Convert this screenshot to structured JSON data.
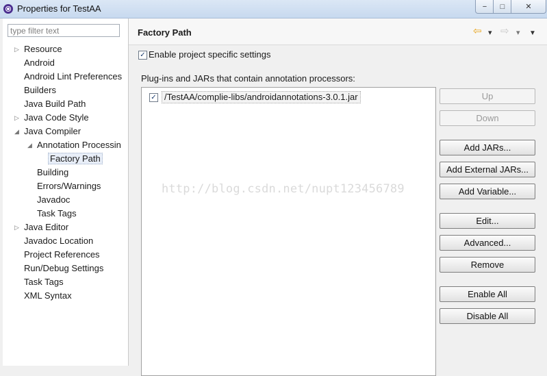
{
  "window": {
    "title": "Properties for TestAA",
    "min_label": "−",
    "max_label": "□",
    "close_label": "✕"
  },
  "filter": {
    "placeholder": "type filter text"
  },
  "tree": [
    {
      "label": "Resource",
      "expander": "▷"
    },
    {
      "label": "Android",
      "expander": ""
    },
    {
      "label": "Android Lint Preferences",
      "expander": ""
    },
    {
      "label": "Builders",
      "expander": ""
    },
    {
      "label": "Java Build Path",
      "expander": ""
    },
    {
      "label": "Java Code Style",
      "expander": "▷"
    },
    {
      "label": "Java Compiler",
      "expander": "◢"
    },
    {
      "label": "Annotation Processin",
      "expander": "◢"
    },
    {
      "label": "Factory Path",
      "expander": ""
    },
    {
      "label": "Building",
      "expander": ""
    },
    {
      "label": "Errors/Warnings",
      "expander": ""
    },
    {
      "label": "Javadoc",
      "expander": ""
    },
    {
      "label": "Task Tags",
      "expander": ""
    },
    {
      "label": "Java Editor",
      "expander": "▷"
    },
    {
      "label": "Javadoc Location",
      "expander": ""
    },
    {
      "label": "Project References",
      "expander": ""
    },
    {
      "label": "Run/Debug Settings",
      "expander": ""
    },
    {
      "label": "Task Tags",
      "expander": ""
    },
    {
      "label": "XML Syntax",
      "expander": ""
    }
  ],
  "page": {
    "title": "Factory Path",
    "enable_label": "Enable project specific settings",
    "enable_checked": true,
    "plugins_label": "Plug-ins and JARs that contain annotation processors:",
    "jars": [
      {
        "path": "/TestAA/complie-libs/androidannotations-3.0.1.jar",
        "checked": true
      }
    ]
  },
  "buttons": {
    "up": "Up",
    "down": "Down",
    "add_jars": "Add JARs...",
    "add_external_jars": "Add External JARs...",
    "add_variable": "Add Variable...",
    "edit": "Edit...",
    "advanced": "Advanced...",
    "remove": "Remove",
    "enable_all": "Enable All",
    "disable_all": "Disable All"
  },
  "nav_icons": {
    "back": "⇦",
    "dropdown": "▾",
    "forward": "⇨",
    "menu": "▼"
  },
  "watermark": "http://blog.csdn.net/nupt123456789",
  "colors": {
    "back_arrow": "#e8a317",
    "forward_arrow": "#c8c8c8"
  }
}
